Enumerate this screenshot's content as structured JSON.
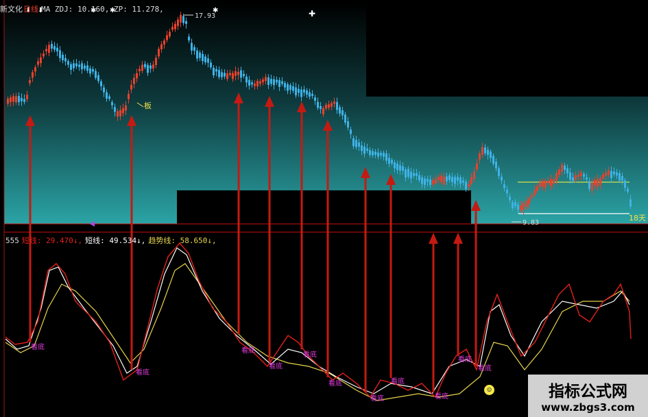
{
  "top_header": {
    "stock_name": "新文化",
    "period": "日线",
    "ma_text": "MA ZDJ: 10.160, ZP: 11.278,"
  },
  "peak_label": "17.93",
  "low_label": "9.83",
  "board_label": "板",
  "days_label": "18天",
  "sub_header": {
    "indicator_id": "555",
    "fast_label": "短线: 29.470↓,",
    "short_label": "短线: 49.534↓,",
    "trend_label": "趋势线: 58.650↓,"
  },
  "signal_label": "看底",
  "watermark": {
    "title": "指标公式网",
    "url": "www.zbgs3.com"
  },
  "colors": {
    "up": "#e8412c",
    "down": "#3fb2e6",
    "arrow": "#c41a12",
    "signal": "#e23bdf",
    "fast_line": "#e3211b",
    "short_line": "#ffffff",
    "trend_line": "#e6d44e"
  }
}
